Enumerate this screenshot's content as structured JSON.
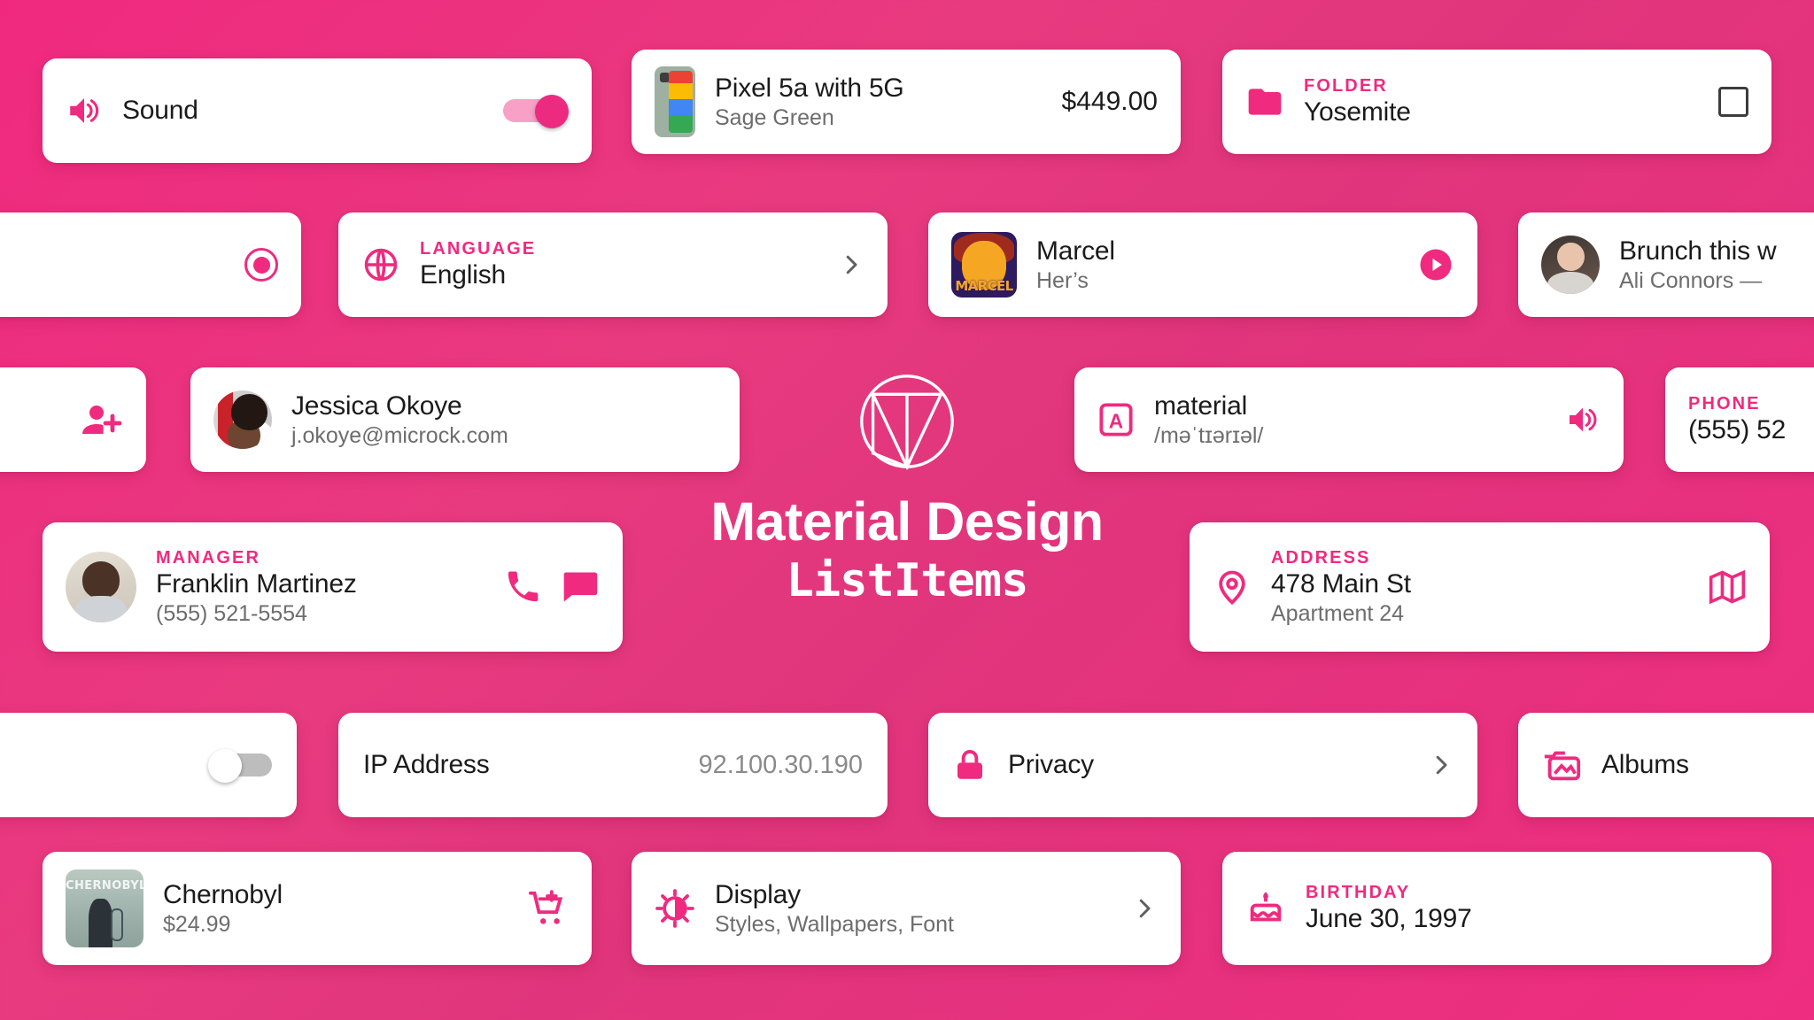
{
  "theme": {
    "accent": "#ef2a7f",
    "background_start": "#f0297f",
    "background_end": "#ef2d80",
    "card_background": "#ffffff",
    "title_text": "#1b1b1b",
    "subtitle_text": "#6d6d6d"
  },
  "brand": {
    "logo_icon": "material-design-logo-icon",
    "title": "Material Design",
    "subtitle": "ListItems"
  },
  "cards": {
    "sound": {
      "icon": "volume-up-icon",
      "title": "Sound",
      "switch_state": "on"
    },
    "pixel": {
      "thumbnail": "pixel-phone-thumbnail",
      "title": "Pixel 5a with 5G",
      "subtitle": "Sage Green",
      "price": "$449.00"
    },
    "folder": {
      "icon": "folder-icon",
      "overline": "FOLDER",
      "title": "Yosemite",
      "checkbox_state": "unchecked"
    },
    "radio": {
      "control": "radio-button-selected"
    },
    "language": {
      "icon": "globe-icon",
      "overline": "LANGUAGE",
      "title": "English",
      "chevron": "chevron-right-icon"
    },
    "marcel": {
      "album_art": "marcel-album-art",
      "album_wordmark": "MARCEL",
      "title": "Marcel",
      "subtitle": "Her’s",
      "action_icon": "play-circle-icon"
    },
    "brunch": {
      "avatar": "ali-connors-avatar",
      "title": "Brunch this w",
      "subtitle": "Ali Connors —"
    },
    "add_person": {
      "icon": "person-add-icon"
    },
    "jessica": {
      "avatar": "jessica-okoye-avatar",
      "title": "Jessica Okoye",
      "subtitle": "j.okoye@microck.com"
    },
    "material_word": {
      "icon": "letter-a-box-icon",
      "title": "material",
      "subtitle": "/məˈtɪərɪəl/",
      "action_icon": "volume-up-icon"
    },
    "phone": {
      "overline": "PHONE",
      "title": "(555) 52"
    },
    "manager": {
      "avatar": "franklin-martinez-avatar",
      "overline": "MANAGER",
      "title": "Franklin Martinez",
      "subtitle": "(555) 521-5554",
      "action_icon_1": "phone-icon",
      "action_icon_2": "message-icon"
    },
    "address": {
      "icon": "location-pin-icon",
      "overline": "ADDRESS",
      "title": "478 Main St",
      "subtitle": "Apartment 24",
      "action_icon": "map-icon"
    },
    "toggle_off": {
      "switch_state": "off"
    },
    "ip_address": {
      "title": "IP Address",
      "value": "92.100.30.190"
    },
    "privacy": {
      "icon": "lock-icon",
      "title": "Privacy",
      "chevron": "chevron-right-icon"
    },
    "albums": {
      "icon": "photo-album-icon",
      "title": "Albums"
    },
    "chernobyl": {
      "poster": "chernobyl-poster",
      "poster_wordmark": "CHERNOBYL",
      "title": "Chernobyl",
      "price": "$24.99",
      "action_icon": "add-shopping-cart-icon"
    },
    "display": {
      "icon": "brightness-contrast-icon",
      "title": "Display",
      "subtitle": "Styles, Wallpapers, Font",
      "chevron": "chevron-right-icon"
    },
    "birthday": {
      "icon": "birthday-cake-icon",
      "overline": "BIRTHDAY",
      "title": "June 30, 1997"
    }
  }
}
